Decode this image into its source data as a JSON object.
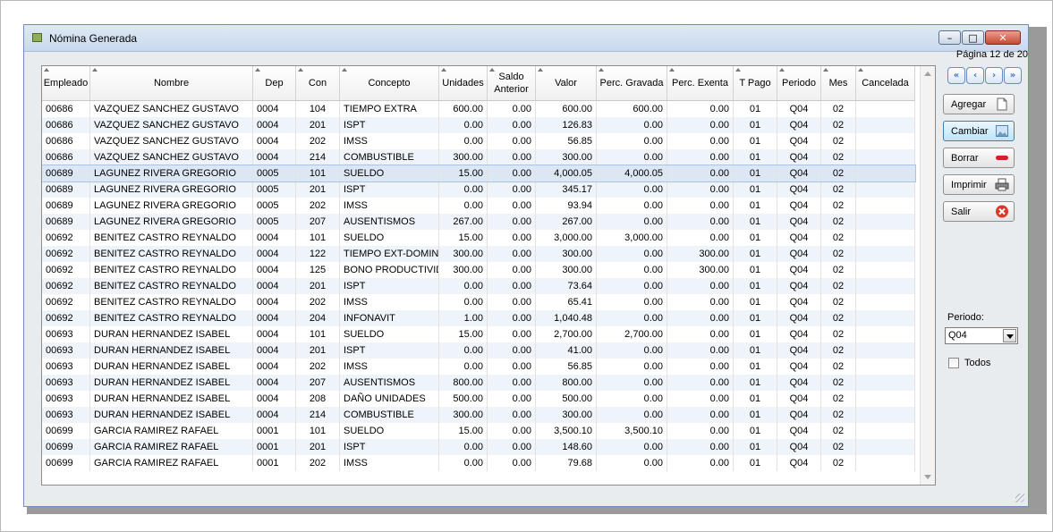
{
  "window": {
    "title": "Nómina Generada",
    "close_glyph": "✕",
    "min_glyph": "–",
    "max_glyph": "□"
  },
  "pagination": {
    "label": "Página 12 de 20",
    "first": "«",
    "prev": "‹",
    "next": "›",
    "last": "»"
  },
  "actions": {
    "add": "Agregar",
    "change": "Cambiar",
    "delete": "Borrar",
    "print": "Imprimir",
    "exit": "Salir"
  },
  "filters": {
    "periodo_label": "Periodo:",
    "periodo_value": "Q04",
    "todos_label": "Todos"
  },
  "grid": {
    "columns": [
      "Empleado",
      "Nombre",
      "Dep",
      "Con",
      "Concepto",
      "Unidades",
      "Saldo Anterior",
      "Valor",
      "Perc. Gravada",
      "Perc. Exenta",
      "T Pago",
      "Periodo",
      "Mes",
      "Cancelada"
    ],
    "rows": [
      [
        "00686",
        "VAZQUEZ SANCHEZ GUSTAVO",
        "0004",
        "104",
        "TIEMPO EXTRA",
        "600.00",
        "0.00",
        "600.00",
        "600.00",
        "0.00",
        "01",
        "Q04",
        "02",
        ""
      ],
      [
        "00686",
        "VAZQUEZ SANCHEZ GUSTAVO",
        "0004",
        "201",
        "ISPT",
        "0.00",
        "0.00",
        "126.83",
        "0.00",
        "0.00",
        "01",
        "Q04",
        "02",
        ""
      ],
      [
        "00686",
        "VAZQUEZ SANCHEZ GUSTAVO",
        "0004",
        "202",
        "IMSS",
        "0.00",
        "0.00",
        "56.85",
        "0.00",
        "0.00",
        "01",
        "Q04",
        "02",
        ""
      ],
      [
        "00686",
        "VAZQUEZ SANCHEZ GUSTAVO",
        "0004",
        "214",
        "COMBUSTIBLE",
        "300.00",
        "0.00",
        "300.00",
        "0.00",
        "0.00",
        "01",
        "Q04",
        "02",
        ""
      ],
      [
        "00689",
        "LAGUNEZ RIVERA GREGORIO",
        "0005",
        "101",
        "SUELDO",
        "15.00",
        "0.00",
        "4,000.05",
        "4,000.05",
        "0.00",
        "01",
        "Q04",
        "02",
        ""
      ],
      [
        "00689",
        "LAGUNEZ RIVERA GREGORIO",
        "0005",
        "201",
        "ISPT",
        "0.00",
        "0.00",
        "345.17",
        "0.00",
        "0.00",
        "01",
        "Q04",
        "02",
        ""
      ],
      [
        "00689",
        "LAGUNEZ RIVERA GREGORIO",
        "0005",
        "202",
        "IMSS",
        "0.00",
        "0.00",
        "93.94",
        "0.00",
        "0.00",
        "01",
        "Q04",
        "02",
        ""
      ],
      [
        "00689",
        "LAGUNEZ RIVERA GREGORIO",
        "0005",
        "207",
        "AUSENTISMOS",
        "267.00",
        "0.00",
        "267.00",
        "0.00",
        "0.00",
        "01",
        "Q04",
        "02",
        ""
      ],
      [
        "00692",
        "BENITEZ CASTRO REYNALDO",
        "0004",
        "101",
        "SUELDO",
        "15.00",
        "0.00",
        "3,000.00",
        "3,000.00",
        "0.00",
        "01",
        "Q04",
        "02",
        ""
      ],
      [
        "00692",
        "BENITEZ CASTRO REYNALDO",
        "0004",
        "122",
        "TIEMPO EXT-DOMING",
        "300.00",
        "0.00",
        "300.00",
        "0.00",
        "300.00",
        "01",
        "Q04",
        "02",
        ""
      ],
      [
        "00692",
        "BENITEZ CASTRO REYNALDO",
        "0004",
        "125",
        "BONO PRODUCTIVIDA",
        "300.00",
        "0.00",
        "300.00",
        "0.00",
        "300.00",
        "01",
        "Q04",
        "02",
        ""
      ],
      [
        "00692",
        "BENITEZ CASTRO REYNALDO",
        "0004",
        "201",
        "ISPT",
        "0.00",
        "0.00",
        "73.64",
        "0.00",
        "0.00",
        "01",
        "Q04",
        "02",
        ""
      ],
      [
        "00692",
        "BENITEZ CASTRO REYNALDO",
        "0004",
        "202",
        "IMSS",
        "0.00",
        "0.00",
        "65.41",
        "0.00",
        "0.00",
        "01",
        "Q04",
        "02",
        ""
      ],
      [
        "00692",
        "BENITEZ CASTRO REYNALDO",
        "0004",
        "204",
        "INFONAVIT",
        "1.00",
        "0.00",
        "1,040.48",
        "0.00",
        "0.00",
        "01",
        "Q04",
        "02",
        ""
      ],
      [
        "00693",
        "DURAN HERNANDEZ ISABEL",
        "0004",
        "101",
        "SUELDO",
        "15.00",
        "0.00",
        "2,700.00",
        "2,700.00",
        "0.00",
        "01",
        "Q04",
        "02",
        ""
      ],
      [
        "00693",
        "DURAN HERNANDEZ ISABEL",
        "0004",
        "201",
        "ISPT",
        "0.00",
        "0.00",
        "41.00",
        "0.00",
        "0.00",
        "01",
        "Q04",
        "02",
        ""
      ],
      [
        "00693",
        "DURAN HERNANDEZ ISABEL",
        "0004",
        "202",
        "IMSS",
        "0.00",
        "0.00",
        "56.85",
        "0.00",
        "0.00",
        "01",
        "Q04",
        "02",
        ""
      ],
      [
        "00693",
        "DURAN HERNANDEZ ISABEL",
        "0004",
        "207",
        "AUSENTISMOS",
        "800.00",
        "0.00",
        "800.00",
        "0.00",
        "0.00",
        "01",
        "Q04",
        "02",
        ""
      ],
      [
        "00693",
        "DURAN HERNANDEZ ISABEL",
        "0004",
        "208",
        "DAÑO UNIDADES",
        "500.00",
        "0.00",
        "500.00",
        "0.00",
        "0.00",
        "01",
        "Q04",
        "02",
        ""
      ],
      [
        "00693",
        "DURAN HERNANDEZ ISABEL",
        "0004",
        "214",
        "COMBUSTIBLE",
        "300.00",
        "0.00",
        "300.00",
        "0.00",
        "0.00",
        "01",
        "Q04",
        "02",
        ""
      ],
      [
        "00699",
        "GARCIA RAMIREZ RAFAEL",
        "0001",
        "101",
        "SUELDO",
        "15.00",
        "0.00",
        "3,500.10",
        "3,500.10",
        "0.00",
        "01",
        "Q04",
        "02",
        ""
      ],
      [
        "00699",
        "GARCIA RAMIREZ RAFAEL",
        "0001",
        "201",
        "ISPT",
        "0.00",
        "0.00",
        "148.60",
        "0.00",
        "0.00",
        "01",
        "Q04",
        "02",
        ""
      ],
      [
        "00699",
        "GARCIA RAMIREZ RAFAEL",
        "0001",
        "202",
        "IMSS",
        "0.00",
        "0.00",
        "79.68",
        "0.00",
        "0.00",
        "01",
        "Q04",
        "02",
        ""
      ]
    ],
    "selected_row": 4
  },
  "colors": {
    "selected_row": "#dde7f4",
    "alt_row": "#eef4fa",
    "delete_icon": "#d0202a",
    "exit_icon": "#d83a2a"
  },
  "icons": {
    "add": "document-icon",
    "change": "picture-icon",
    "delete": "minus-icon",
    "print": "printer-icon",
    "exit": "close-circle-icon"
  }
}
